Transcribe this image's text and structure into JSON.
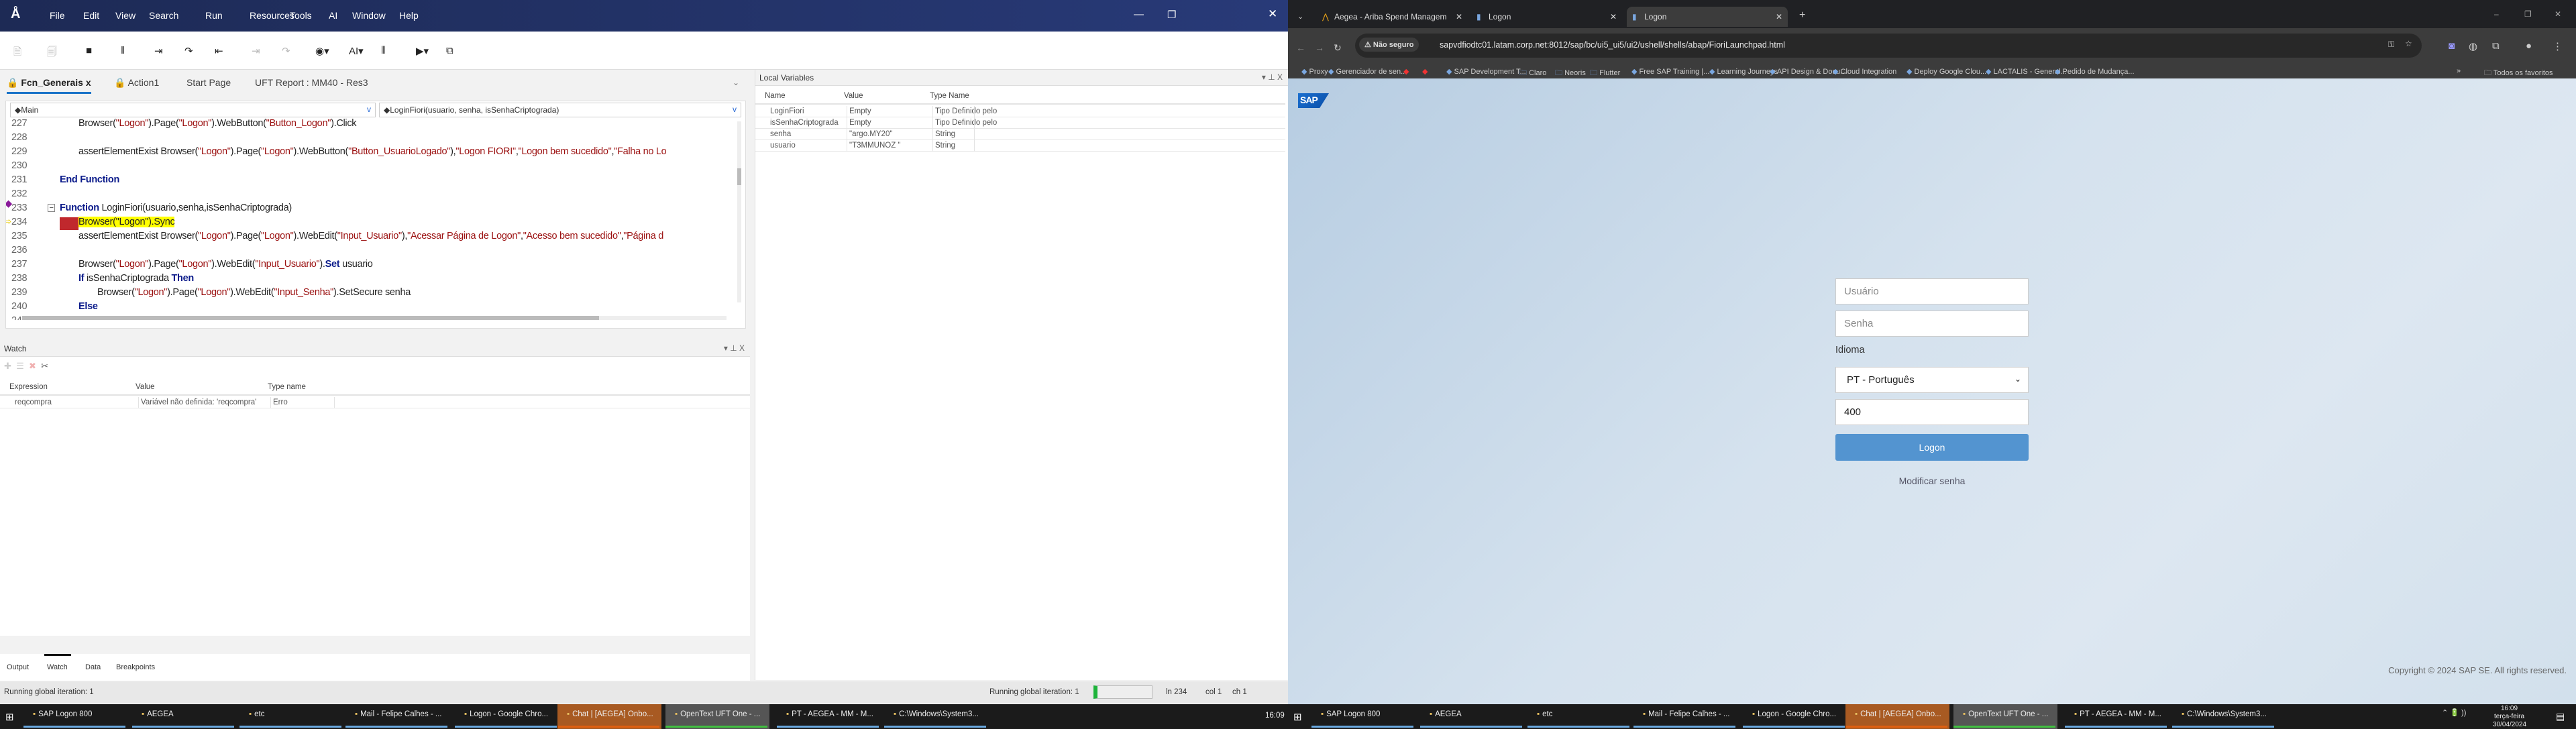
{
  "uft": {
    "menu": [
      "File",
      "Edit",
      "View",
      "Search",
      "Run",
      "Resources",
      "Tools",
      "AI",
      "Window",
      "Help"
    ],
    "tabs": [
      "Fcn_Generais",
      "Action1",
      "Start Page",
      "UFT Report : MM40 - Res3"
    ],
    "tab_close": "x",
    "scope_dropdown": "Main",
    "function_dropdown": "LoginFiori(usuario, senha, isSenhaCriptograda)",
    "code": [
      {
        "n": "227",
        "i": 1,
        "t": [
          {
            "t": "Browser(",
            "c": "n"
          },
          {
            "t": "\"Logon\"",
            "c": "s"
          },
          {
            "t": ").Page(",
            "c": "n"
          },
          {
            "t": "\"Logon\"",
            "c": "s"
          },
          {
            "t": ").WebButton(",
            "c": "n"
          },
          {
            "t": "\"Button_Logon\"",
            "c": "s"
          },
          {
            "t": ").Click",
            "c": "n"
          }
        ]
      },
      {
        "n": "228",
        "i": 1,
        "t": []
      },
      {
        "n": "229",
        "i": 1,
        "t": [
          {
            "t": "assertElementExist Browser(",
            "c": "n"
          },
          {
            "t": "\"Logon\"",
            "c": "s"
          },
          {
            "t": ").Page(",
            "c": "n"
          },
          {
            "t": "\"Logon\"",
            "c": "s"
          },
          {
            "t": ").WebButton(",
            "c": "n"
          },
          {
            "t": "\"Button_UsuarioLogado\"",
            "c": "s"
          },
          {
            "t": "),",
            "c": "n"
          },
          {
            "t": "\"Logon FIORI\"",
            "c": "s"
          },
          {
            "t": ",",
            "c": "n"
          },
          {
            "t": "\"Logon bem sucedido\"",
            "c": "s"
          },
          {
            "t": ",",
            "c": "n"
          },
          {
            "t": "\"Falha no Lo",
            "c": "s"
          }
        ]
      },
      {
        "n": "230",
        "i": 1,
        "t": []
      },
      {
        "n": "231",
        "i": 0,
        "t": [
          {
            "t": "End Function",
            "c": "k"
          }
        ]
      },
      {
        "n": "232",
        "i": 0,
        "t": []
      },
      {
        "n": "233",
        "i": 0,
        "t": [
          {
            "t": "Function",
            "c": "k"
          },
          {
            "t": " LoginFiori(usuario,senha,isSenhaCriptograda)",
            "c": "n"
          }
        ]
      },
      {
        "n": "234",
        "i": 1,
        "t": [
          {
            "t": "Browser(\"Logon\").Sync",
            "c": "n"
          }
        ]
      },
      {
        "n": "235",
        "i": 1,
        "t": [
          {
            "t": "assertElementExist Browser(",
            "c": "n"
          },
          {
            "t": "\"Logon\"",
            "c": "s"
          },
          {
            "t": ").Page(",
            "c": "n"
          },
          {
            "t": "\"Logon\"",
            "c": "s"
          },
          {
            "t": ").WebEdit(",
            "c": "n"
          },
          {
            "t": "\"Input_Usuario\"",
            "c": "s"
          },
          {
            "t": "),",
            "c": "n"
          },
          {
            "t": "\"Acessar Página de Logon\"",
            "c": "s"
          },
          {
            "t": ",",
            "c": "n"
          },
          {
            "t": "\"Acesso bem sucedido\"",
            "c": "s"
          },
          {
            "t": ",",
            "c": "n"
          },
          {
            "t": "\"Página d",
            "c": "s"
          }
        ]
      },
      {
        "n": "236",
        "i": 1,
        "t": []
      },
      {
        "n": "237",
        "i": 1,
        "t": [
          {
            "t": "Browser(",
            "c": "n"
          },
          {
            "t": "\"Logon\"",
            "c": "s"
          },
          {
            "t": ").Page(",
            "c": "n"
          },
          {
            "t": "\"Logon\"",
            "c": "s"
          },
          {
            "t": ").WebEdit(",
            "c": "n"
          },
          {
            "t": "\"Input_Usuario\"",
            "c": "s"
          },
          {
            "t": ").",
            "c": "n"
          },
          {
            "t": "Set",
            "c": "k"
          },
          {
            "t": " usuario",
            "c": "n"
          }
        ]
      },
      {
        "n": "238",
        "i": 1,
        "t": [
          {
            "t": "If",
            "c": "k"
          },
          {
            "t": " isSenhaCriptograda ",
            "c": "n"
          },
          {
            "t": "Then",
            "c": "k"
          }
        ]
      },
      {
        "n": "239",
        "i": 2,
        "t": [
          {
            "t": "Browser(",
            "c": "n"
          },
          {
            "t": "\"Logon\"",
            "c": "s"
          },
          {
            "t": ").Page(",
            "c": "n"
          },
          {
            "t": "\"Logon\"",
            "c": "s"
          },
          {
            "t": ").WebEdit(",
            "c": "n"
          },
          {
            "t": "\"Input_Senha\"",
            "c": "s"
          },
          {
            "t": ").SetSecure senha",
            "c": "n"
          }
        ]
      },
      {
        "n": "240",
        "i": 1,
        "t": [
          {
            "t": "Else",
            "c": "k"
          }
        ]
      },
      {
        "n": "241",
        "i": 2,
        "t": [
          {
            "t": "Browser(",
            "c": "n"
          },
          {
            "t": "\"Logon\"",
            "c": "s"
          },
          {
            "t": ").Page(",
            "c": "n"
          },
          {
            "t": "\"Logon\"",
            "c": "s"
          },
          {
            "t": ").WebEdit(",
            "c": "n"
          },
          {
            "t": "\"Input_Senha\"",
            "c": "s"
          },
          {
            "t": ").",
            "c": "n"
          },
          {
            "t": "Set",
            "c": "k"
          },
          {
            "t": " senha",
            "c": "n"
          }
        ]
      }
    ],
    "local_variables": {
      "title": "Local Variables",
      "columns": [
        "Name",
        "Value",
        "Type Name"
      ],
      "rows": [
        [
          "LoginFiori",
          "Empty",
          "Tipo Definido pelo"
        ],
        [
          "isSenhaCriptograda",
          "Empty",
          "Tipo Definido pelo"
        ],
        [
          "senha",
          "\"argo.MY20\"",
          "String"
        ],
        [
          "usuario",
          "\"T3MMUNOZ \"",
          "String"
        ]
      ]
    },
    "watch": {
      "title": "Watch",
      "columns": [
        "Expression",
        "Value",
        "Type name"
      ],
      "rows": [
        [
          "reqcompra",
          "Variável não definida: 'reqcompra'",
          "Erro"
        ]
      ]
    },
    "panel_controls": "▾ ⊥ X",
    "bottom_tabs": [
      "Output",
      "Watch",
      "Data",
      "Breakpoints"
    ],
    "status_left": "Running global iteration: 1",
    "status_right": "Running global iteration: 1",
    "ln": "ln 234",
    "col": "col 1",
    "ch": "ch 1",
    "highlight_color": "#ffff00",
    "breakpoint_color": "#c0282d"
  },
  "chrome": {
    "tabs": [
      "Aegea - Ariba Spend Managem",
      "Logon",
      "Logon"
    ],
    "not_secure": "Não seguro",
    "url": "sapvdfiodtc01.latam.corp.net:8012/sap/bc/ui5_ui5/ui2/ushell/shells/abap/FioriLaunchpad.html",
    "bookmarks": [
      "Proxy",
      "Gerenciador de sen...",
      "",
      "",
      "SAP Development T...",
      "Claro",
      "Neoris",
      "Flutter",
      "Free SAP Training |...",
      "Learning Journeys",
      "API Design & Docu...",
      "Cloud Integration",
      "Deploy Google Clou...",
      "LACTALIS - General...",
      "Pedido de Mudança..."
    ],
    "all_favorites": "Todos os favoritos"
  },
  "sap": {
    "logo": "SAP",
    "user_placeholder": "Usuário",
    "password_placeholder": "Senha",
    "language_label": "Idioma",
    "language": "PT - Português",
    "client": "400",
    "logon": "Logon",
    "change_password": "Modificar senha",
    "copyright": "Copyright © 2024 SAP SE. All rights reserved.",
    "button_color": "#5394d0"
  },
  "taskbar": {
    "items": [
      "SAP Logon 800",
      "AEGEA",
      "etc",
      "Mail - Felipe Calhes - ...",
      "Logon - Google Chro...",
      "Chat | [AEGEA] Onbo...",
      "OpenText UFT One - ...",
      "PT - AEGEA - MM - M...",
      "C:\\Windows\\System3..."
    ],
    "time": "16:09",
    "weekday": "terça-feira",
    "date": "30/04/2024"
  }
}
